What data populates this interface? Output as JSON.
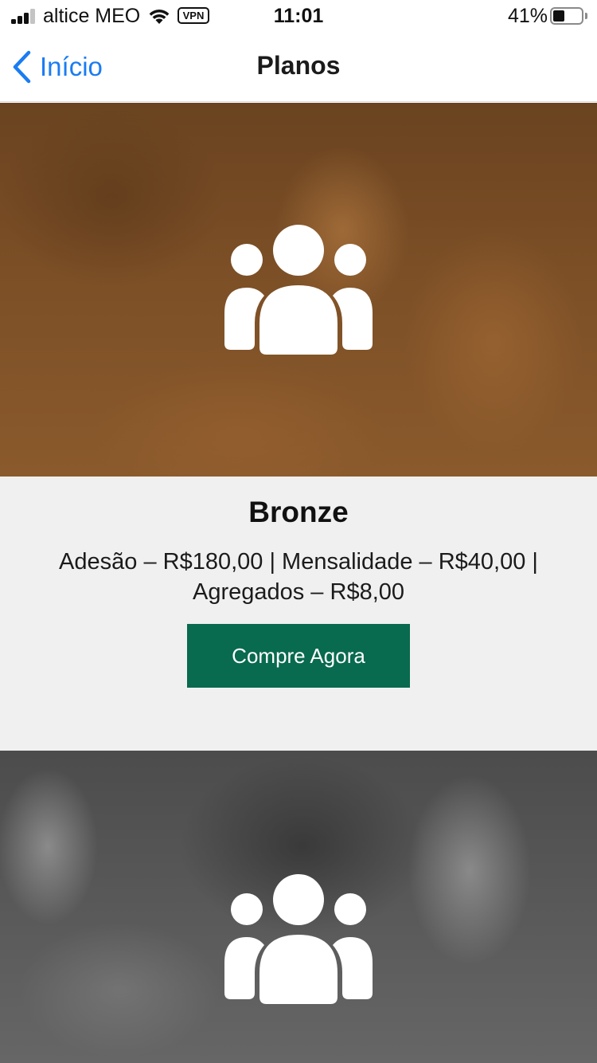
{
  "status_bar": {
    "carrier": "altice MEO",
    "vpn": "VPN",
    "time": "11:01",
    "battery_pct": "41%",
    "battery_level": 0.41,
    "signal_bars": 3
  },
  "nav": {
    "back_label": "Início",
    "title": "Planos",
    "accent_color": "#1a7cf2"
  },
  "plans": [
    {
      "name": "Bronze",
      "price": "Adesão – R$180,00 | Mensalidade – R$40,00 | Agregados – R$8,00",
      "button": "Compre Agora",
      "button_color": "#086a4e",
      "icon": "family-icon",
      "image_tint": "#7c4f26"
    },
    {
      "icon": "family-icon",
      "image_tint": "#595959"
    }
  ]
}
